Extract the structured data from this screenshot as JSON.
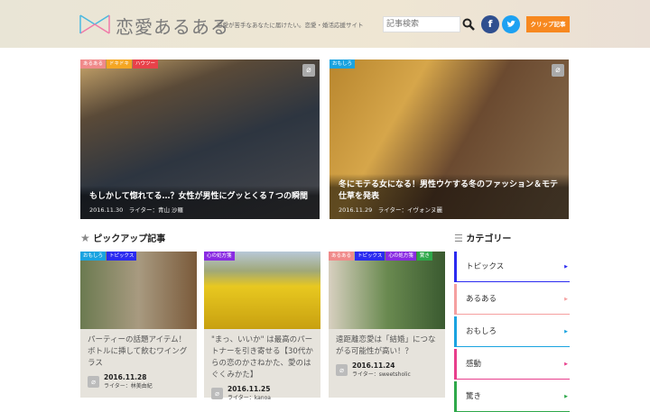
{
  "header": {
    "site_title": "恋愛あるある",
    "tagline": "恋愛が苦手なあなたに届けたい。恋愛・婚活応援サイト",
    "search_placeholder": "記事検索",
    "facebook": "f",
    "twitter": "t",
    "clip_label": "クリップ記事"
  },
  "featured": [
    {
      "tags": [
        {
          "label": "あるある",
          "color": "#f08a8a"
        },
        {
          "label": "ドキドキ",
          "color": "#f5a623"
        },
        {
          "label": "ハウツー",
          "color": "#e8424a"
        }
      ],
      "title": "もしかして惚れてる…？女性が男性にグッとくる７つの瞬間",
      "date": "2016.11.30",
      "writer": "ライター：青山 沙羅"
    },
    {
      "tags": [
        {
          "label": "おもしろ",
          "color": "#1aa3e0"
        }
      ],
      "title": "冬にモテる女になる！男性ウケする冬のファッション＆モテ仕草を発表",
      "date": "2016.11.29",
      "writer": "ライター：イヴォンヌ麗"
    }
  ],
  "pickup": {
    "heading": "ピックアップ記事",
    "items": [
      {
        "tags": [
          {
            "label": "おもしろ",
            "color": "#1aa3e0"
          },
          {
            "label": "トピックス",
            "color": "#2b2bf0"
          }
        ],
        "title": "パーティーの話題アイテム！ボトルに挿して飲むワイングラス",
        "date": "2016.11.28",
        "writer": "ライター：林美由紀"
      },
      {
        "tags": [
          {
            "label": "心の処方箋",
            "color": "#8a2be2"
          }
        ],
        "title": "\"まっ、いいか\" は最高のパートナーを引き寄せる【30代からの恋のかさねかた、愛のはぐくみかた】",
        "date": "2016.11.25",
        "writer": "ライター：kanoa"
      },
      {
        "tags": [
          {
            "label": "あるある",
            "color": "#f08a8a"
          },
          {
            "label": "トピックス",
            "color": "#2b2bf0"
          },
          {
            "label": "心の処方箋",
            "color": "#8a2be2"
          },
          {
            "label": "驚き",
            "color": "#2ea84a"
          }
        ],
        "title": "遠距離恋愛は「結婚」につながる可能性が高い！？",
        "date": "2016.11.24",
        "writer": "ライター：sweetsholic"
      }
    ]
  },
  "categories": {
    "heading": "カテゴリー",
    "items": [
      {
        "label": "トピックス",
        "color": "#2b2bf0"
      },
      {
        "label": "あるある",
        "color": "#f5a0a0"
      },
      {
        "label": "おもしろ",
        "color": "#1aa3e0"
      },
      {
        "label": "感動",
        "color": "#e83e8c"
      },
      {
        "label": "驚き",
        "color": "#2ea84a"
      }
    ]
  }
}
